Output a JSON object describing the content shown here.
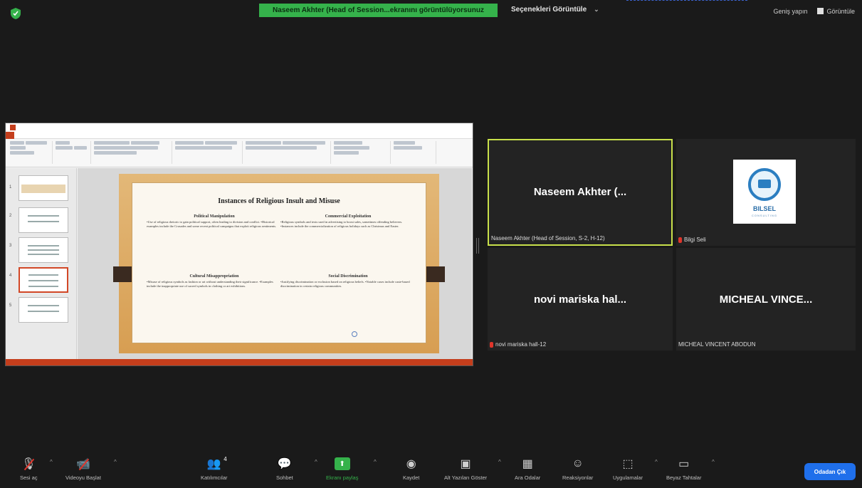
{
  "top": {
    "share_banner": "Naseem Akhter (Head of Session...ekranını görüntülüyorsunuz",
    "view_options": "Seçenekleri Görüntüle",
    "exit_fullscreen": "Geniş yapın",
    "view": "Görüntüle"
  },
  "shared_screen": {
    "slide_title": "Instances of Religious Insult and Misuse",
    "blocks": [
      {
        "heading": "Political Manipulation",
        "text": "•Use of religious rhetoric to gain political support, often leading to division and conflict. •Historical examples include the Crusades and some recent political campaigns that exploit religious sentiments."
      },
      {
        "heading": "Commercial Exploitation",
        "text": "•Religious symbols and texts used in advertising to boost sales, sometimes offending believers. •Instances include the commercialization of religious holidays such as Christmas and Easter."
      },
      {
        "heading": "Cultural Misappropriation",
        "text": "•Misuse of religious symbols as fashion or art without understanding their significance. •Examples include the inappropriate use of sacred symbols in clothing or art exhibitions."
      },
      {
        "heading": "Social Discrimination",
        "text": "•Justifying discrimination or exclusion based on religious beliefs. •Notable cases include caste-based discrimination in certain religious communities."
      }
    ]
  },
  "participants": [
    {
      "big_name": "Naseem Akhter (...",
      "label": "Naseem Akhter (Head of Session, S-2, H-12)",
      "muted": false,
      "active": true
    },
    {
      "big_name": "",
      "label": "Bilgi Seli",
      "muted": true,
      "logo_text": "BILSEL",
      "logo_sub": "CONSULTING"
    },
    {
      "big_name": "novi mariska hal...",
      "label": "novi mariska hall-12",
      "muted": true
    },
    {
      "big_name": "MICHEAL VINCE...",
      "label": "MICHEAL VINCENT ABODUN",
      "muted": false
    }
  ],
  "toolbar": {
    "unmute": "Sesi aç",
    "start_video": "Videoyu Başlat",
    "participants": "Katılımcılar",
    "participants_count": "4",
    "chat": "Sohbet",
    "share_screen": "Ekranı paylaş",
    "record": "Kaydet",
    "captions": "Alt Yazıları Göster",
    "breakout": "Ara Odalar",
    "reactions": "Reaksiyonlar",
    "apps": "Uygulamalar",
    "whiteboards": "Beyaz Tahtalar",
    "leave": "Odadan Çık"
  },
  "colors": {
    "accent_green": "#35b24b",
    "active_speaker": "#c8e04a",
    "leave_blue": "#1f6feb",
    "ppt_red": "#c43e1c"
  }
}
